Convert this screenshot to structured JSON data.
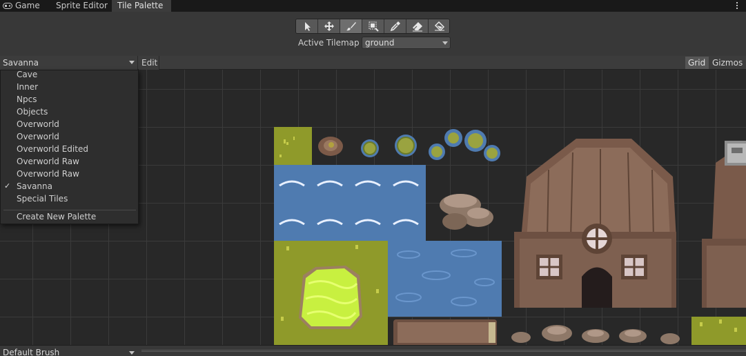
{
  "tabs": [
    {
      "label": "Game",
      "icon": "gamepad-icon"
    },
    {
      "label": "Sprite Editor"
    },
    {
      "label": "Tile Palette",
      "active": true
    }
  ],
  "toolbar": {
    "tools": [
      "select-tool-icon",
      "move-tool-icon",
      "paint-brush-icon",
      "box-fill-icon",
      "picker-icon",
      "eraser-icon",
      "fill-bucket-icon"
    ],
    "active_tool": "paint-brush-icon",
    "active_tilemap_label": "Active Tilemap",
    "active_tilemap_value": "ground"
  },
  "palette_bar": {
    "selected_palette": "Savanna",
    "edit_label": "Edit",
    "grid_label": "Grid",
    "gizmos_label": "Gizmos"
  },
  "palette_menu": {
    "items": [
      "Cave",
      "Inner",
      "Npcs",
      "Objects",
      "Overworld",
      "Overworld",
      "Overworld Edited",
      "Overworld Raw",
      "Overworld Raw",
      "Savanna",
      "Special Tiles"
    ],
    "checked": "Savanna",
    "create_label": "Create New Palette"
  },
  "bottom": {
    "brush": "Default Brush"
  },
  "colors": {
    "grass": "#8f9a2a",
    "water": "#4f7bb0",
    "wood": "#7a5a4a",
    "bright_grass": "#c8f040",
    "canvas_bg": "#282828"
  }
}
